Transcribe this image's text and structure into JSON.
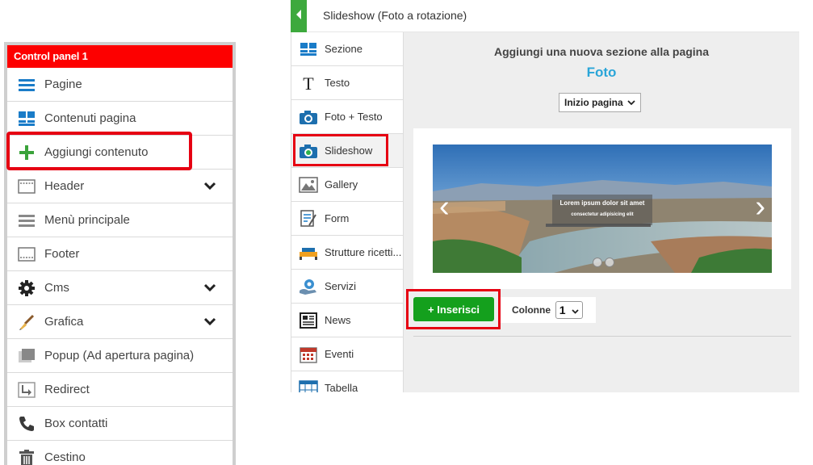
{
  "control_panel": {
    "title": "Control panel 1",
    "items": [
      {
        "label": "Pagine",
        "icon": "list-icon",
        "expandable": false
      },
      {
        "label": "Contenuti pagina",
        "icon": "blocks-icon",
        "expandable": false
      },
      {
        "label": "Aggiungi contenuto",
        "icon": "plus-icon",
        "expandable": false
      },
      {
        "label": "Header",
        "icon": "header-icon",
        "expandable": true
      },
      {
        "label": "Menù principale",
        "icon": "menu-icon",
        "expandable": false
      },
      {
        "label": "Footer",
        "icon": "footer-icon",
        "expandable": false
      },
      {
        "label": "Cms",
        "icon": "gear-icon",
        "expandable": true
      },
      {
        "label": "Grafica",
        "icon": "brush-icon",
        "expandable": true
      },
      {
        "label": "Popup (Ad apertura pagina)",
        "icon": "popup-icon",
        "expandable": false
      },
      {
        "label": "Redirect",
        "icon": "redirect-icon",
        "expandable": false
      },
      {
        "label": "Box contatti",
        "icon": "phone-icon",
        "expandable": false
      },
      {
        "label": "Cestino",
        "icon": "trash-icon",
        "expandable": false
      }
    ]
  },
  "editor": {
    "title": "Slideshow (Foto a rotazione)",
    "menu": [
      {
        "label": "Sezione",
        "icon": "section-icon"
      },
      {
        "label": "Testo",
        "icon": "text-icon"
      },
      {
        "label": "Foto + Testo",
        "icon": "camera-icon"
      },
      {
        "label": "Slideshow",
        "icon": "slideshow-icon",
        "selected": true
      },
      {
        "label": "Gallery",
        "icon": "gallery-icon"
      },
      {
        "label": "Form",
        "icon": "form-icon"
      },
      {
        "label": "Strutture ricetti...",
        "icon": "bed-icon"
      },
      {
        "label": "Servizi",
        "icon": "services-icon"
      },
      {
        "label": "News",
        "icon": "news-icon"
      },
      {
        "label": "Eventi",
        "icon": "calendar-icon"
      },
      {
        "label": "Tabella",
        "icon": "table-icon"
      }
    ],
    "main": {
      "heading": "Aggiungi una nuova sezione alla pagina",
      "section_type": "Foto",
      "position_select": "Inizio pagina",
      "slide_caption_1": "Lorem ipsum dolor sit amet",
      "slide_caption_2": "consectetur adipisicing elit",
      "insert_label": "+ Inserisci",
      "columns_label": "Colonne",
      "columns_value": "1"
    }
  },
  "colors": {
    "header_red": "#fd0000",
    "highlight_red": "#e60012",
    "back_green": "#3da93d",
    "insert_green": "#14a01d",
    "section_blue": "#2aa5d8"
  }
}
